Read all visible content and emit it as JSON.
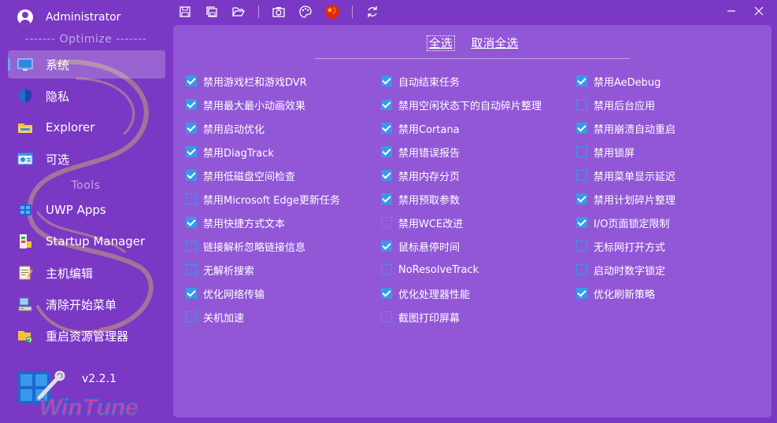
{
  "user": {
    "name": "Administrator"
  },
  "sections": {
    "optimize": "------- Optimize -------",
    "tools": "Tools"
  },
  "nav": [
    {
      "label": "系统",
      "icon": "monitor-icon",
      "active": true
    },
    {
      "label": "隐私",
      "icon": "shield-icon",
      "active": false
    },
    {
      "label": "Explorer",
      "icon": "folder-icon",
      "active": false
    },
    {
      "label": "可选",
      "icon": "settings-window-icon",
      "active": false
    },
    {
      "label": "UWP Apps",
      "icon": "apps-grid-icon",
      "active": false
    },
    {
      "label": "Startup Manager",
      "icon": "startup-icon",
      "active": false
    },
    {
      "label": "主机编辑",
      "icon": "notepad-icon",
      "active": false
    },
    {
      "label": "清除开始菜单",
      "icon": "computer-icon",
      "active": false
    },
    {
      "label": "重启资源管理器",
      "icon": "folder-refresh-icon",
      "active": false
    }
  ],
  "app": {
    "version": "v2.2.1",
    "logo_text": "WinTune"
  },
  "toolbar": [
    "save-icon",
    "save-all-icon",
    "open-folder-icon",
    "camera-icon",
    "palette-icon",
    "china-flag-icon",
    "refresh-icon"
  ],
  "select": {
    "all": "全选",
    "none": "取消全选"
  },
  "options": {
    "col1": [
      {
        "label": "禁用游戏栏和游戏DVR",
        "checked": true
      },
      {
        "label": "禁用最大最小动画效果",
        "checked": true
      },
      {
        "label": "禁用启动优化",
        "checked": true
      },
      {
        "label": "禁用DiagTrack",
        "checked": true
      },
      {
        "label": "禁用低磁盘空间检查",
        "checked": true
      },
      {
        "label": "禁用Microsoft Edge更新任务",
        "checked": false
      },
      {
        "label": "禁用快捷方式文本",
        "checked": true
      },
      {
        "label": "链接解析忽略链接信息",
        "checked": false
      },
      {
        "label": "无解析搜索",
        "checked": false
      },
      {
        "label": "优化网络传输",
        "checked": true
      },
      {
        "label": "关机加速",
        "checked": false
      }
    ],
    "col2": [
      {
        "label": "自动结束任务",
        "checked": true
      },
      {
        "label": "禁用空闲状态下的自动碎片整理",
        "checked": true
      },
      {
        "label": "禁用Cortana",
        "checked": true
      },
      {
        "label": "禁用错误报告",
        "checked": true
      },
      {
        "label": "禁用内存分页",
        "checked": true
      },
      {
        "label": "禁用预取参数",
        "checked": true
      },
      {
        "label": "禁用WCE改进",
        "checked": false
      },
      {
        "label": "鼠标悬停时间",
        "checked": true
      },
      {
        "label": "NoResolveTrack",
        "checked": false
      },
      {
        "label": "优化处理器性能",
        "checked": true
      },
      {
        "label": "截图打印屏幕",
        "checked": false
      }
    ],
    "col3": [
      {
        "label": "禁用AeDebug",
        "checked": true
      },
      {
        "label": "禁用后台应用",
        "checked": false
      },
      {
        "label": "禁用崩溃自动重启",
        "checked": true
      },
      {
        "label": "禁用锁屏",
        "checked": false
      },
      {
        "label": "禁用菜单显示延迟",
        "checked": false
      },
      {
        "label": "禁用计划碎片整理",
        "checked": true
      },
      {
        "label": "I/O页面锁定限制",
        "checked": true
      },
      {
        "label": "无标网打开方式",
        "checked": false
      },
      {
        "label": "启动时数字锁定",
        "checked": false
      },
      {
        "label": "优化刷新策略",
        "checked": true
      }
    ]
  }
}
